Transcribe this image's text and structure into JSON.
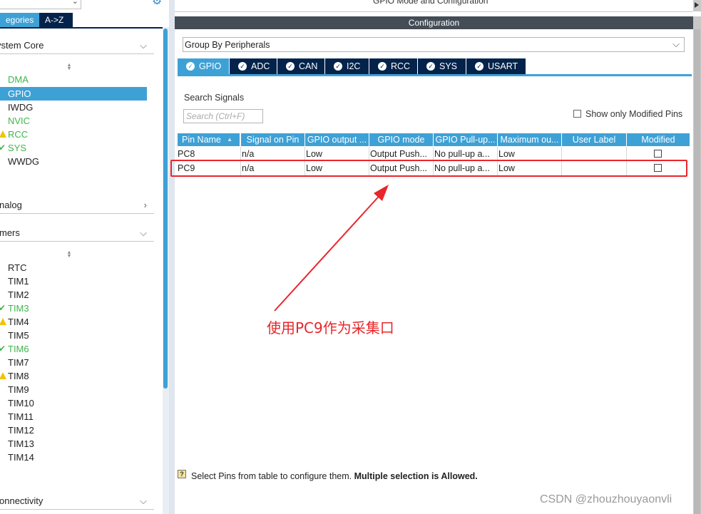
{
  "right_header": {
    "title": "GPIO Mode and Configuration"
  },
  "left": {
    "tabs": [
      {
        "label": "egories"
      },
      {
        "label": "A->Z"
      }
    ],
    "sections": [
      {
        "label": "ystem Core",
        "chevron": "chevron-down"
      },
      {
        "label": "nalog",
        "chevron": "chevron-right"
      },
      {
        "label": "mers",
        "chevron": "chevron-down"
      },
      {
        "label": "onnectivity",
        "chevron": "chevron-down"
      }
    ],
    "system_core_items": [
      {
        "label": "DMA",
        "status": "ok"
      },
      {
        "label": "GPIO",
        "status": "selected"
      },
      {
        "label": "IWDG",
        "status": "none"
      },
      {
        "label": "NVIC",
        "status": "ok"
      },
      {
        "label": "RCC",
        "status": "warning"
      },
      {
        "label": "SYS",
        "status": "check"
      },
      {
        "label": "WWDG",
        "status": "none"
      }
    ],
    "timer_items": [
      {
        "label": "RTC",
        "status": "none"
      },
      {
        "label": "TIM1",
        "status": "none"
      },
      {
        "label": "TIM2",
        "status": "none"
      },
      {
        "label": "TIM3",
        "status": "check"
      },
      {
        "label": "TIM4",
        "status": "warning"
      },
      {
        "label": "TIM5",
        "status": "none"
      },
      {
        "label": "TIM6",
        "status": "check"
      },
      {
        "label": "TIM7",
        "status": "none"
      },
      {
        "label": "TIM8",
        "status": "warning"
      },
      {
        "label": "TIM9",
        "status": "none"
      },
      {
        "label": "TIM10",
        "status": "none"
      },
      {
        "label": "TIM11",
        "status": "none"
      },
      {
        "label": "TIM12",
        "status": "none"
      },
      {
        "label": "TIM13",
        "status": "none"
      },
      {
        "label": "TIM14",
        "status": "none"
      }
    ]
  },
  "config": {
    "title": "Configuration",
    "group_by": "Group By Peripherals",
    "peripheral_tabs": [
      "GPIO",
      "ADC",
      "CAN",
      "I2C",
      "RCC",
      "SYS",
      "USART"
    ],
    "active_tab": "GPIO",
    "search_label": "Search Signals",
    "search_placeholder": "Search (Ctrl+F)",
    "show_modified_label": "Show only Modified Pins",
    "table": {
      "headers": [
        "Pin Name",
        "Signal on Pin",
        "GPIO output ...",
        "GPIO mode",
        "GPIO Pull-up...",
        "Maximum ou...",
        "User Label",
        "Modified"
      ],
      "rows": [
        [
          "PC8",
          "n/a",
          "Low",
          "Output Push...",
          "No pull-up a...",
          "Low",
          "",
          ""
        ],
        [
          "PC9",
          "n/a",
          "Low",
          "Output Push...",
          "No pull-up a...",
          "Low",
          "",
          ""
        ]
      ]
    },
    "hint_normal": "Select Pins from table to configure them. ",
    "hint_bold": "Multiple selection is Allowed."
  },
  "annotation": {
    "text": "使用PC9作为采集口",
    "color": "#e8262b"
  },
  "watermark": "CSDN @zhouzhouyaonvli",
  "colors": {
    "accent": "#3ea1d6",
    "navy": "#03234b",
    "ok_green": "#3fb54c",
    "warning": "#f0c400",
    "annotation_red": "#e8262b"
  }
}
